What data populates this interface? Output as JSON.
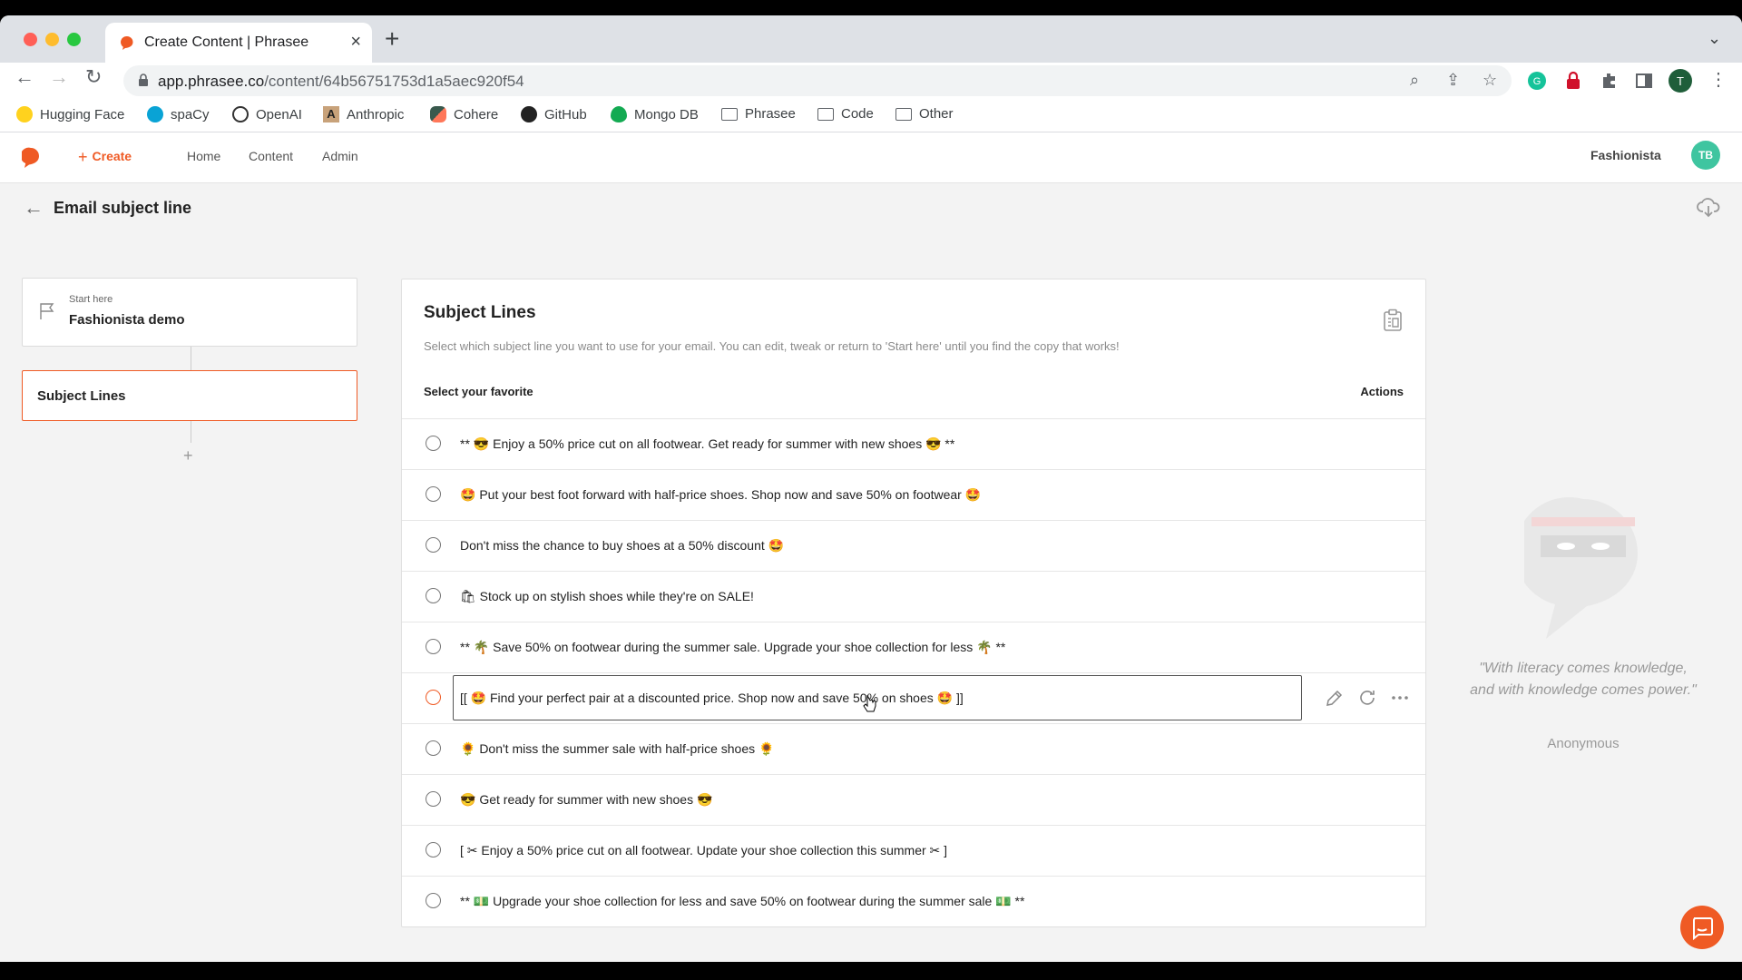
{
  "browser": {
    "tab_title": "Create Content | Phrasee",
    "url_host": "app.phrasee.co",
    "url_path": "/content/64b56751753d1a5aec920f54",
    "profile_initial": "T",
    "bookmarks": [
      {
        "label": "Hugging Face",
        "icon": "hugging-face-icon"
      },
      {
        "label": "spaCy",
        "icon": "spacy-icon"
      },
      {
        "label": "OpenAI",
        "icon": "openai-icon"
      },
      {
        "label": "Anthropic",
        "icon": "anthropic-icon"
      },
      {
        "label": "Cohere",
        "icon": "cohere-icon"
      },
      {
        "label": "GitHub",
        "icon": "github-icon"
      },
      {
        "label": "Mongo DB",
        "icon": "mongodb-icon"
      },
      {
        "label": "Phrasee",
        "icon": "folder-icon"
      },
      {
        "label": "Code",
        "icon": "folder-icon"
      },
      {
        "label": "Other",
        "icon": "folder-icon"
      }
    ]
  },
  "app": {
    "brand_color": "#ef5a24",
    "create_label": "Create",
    "nav": [
      "Home",
      "Content",
      "Admin"
    ],
    "account_name": "Fashionista",
    "avatar_initials": "TB",
    "page_title": "Email subject line"
  },
  "flow": {
    "start_caption": "Start here",
    "start_name": "Fashionista demo",
    "active_step": "Subject Lines",
    "add_label": "+"
  },
  "panel": {
    "title": "Subject Lines",
    "description": "Select which subject line you want to use for your email. You can edit, tweak or return to 'Start here' until you find the copy that works!",
    "col_select": "Select your favorite",
    "col_actions": "Actions",
    "items": [
      "** 😎 Enjoy a 50% price cut on all footwear. Get ready for summer with new shoes 😎 **",
      "🤩 Put your best foot forward with half-price shoes. Shop now and save 50% on footwear 🤩",
      "Don't miss the chance to buy shoes at a 50% discount 🤩",
      "🛍 Stock up on stylish shoes while they're on SALE!",
      "** 🌴 Save 50% on footwear during the summer sale. Upgrade your shoe collection for less 🌴 **",
      "[[ 🤩 Find your perfect pair at a discounted price. Shop now and save 50% on shoes 🤩 ]]",
      "🌻 Don't miss the summer sale with half-price shoes 🌻",
      "😎 Get ready for summer with new shoes 😎",
      "[ ✂ Enjoy a 50% price cut on all footwear. Update your shoe collection this summer ✂ ]",
      "** 💵 Upgrade your shoe collection for less and save 50% on footwear during the summer sale 💵 **"
    ]
  },
  "quote": {
    "text": "\"With literacy comes knowledge, and with knowledge comes power.\"",
    "author": "Anonymous"
  }
}
